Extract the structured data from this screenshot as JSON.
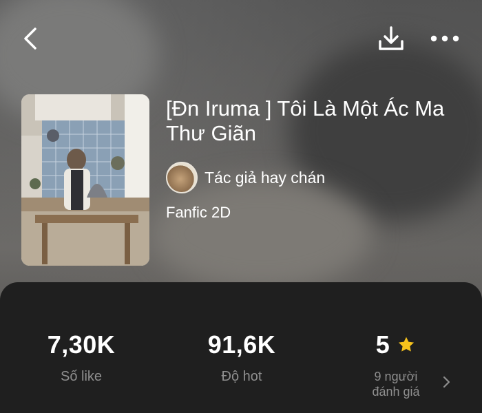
{
  "header": {
    "title": "[Đn Iruma ] Tôi Là Một Ác Ma Thư Giãn",
    "author": "Tác giả hay chán",
    "genre": "Fanfic 2D"
  },
  "stats": {
    "likes": {
      "value": "7,30K",
      "label": "Số like"
    },
    "hot": {
      "value": "91,6K",
      "label": "Độ hot"
    },
    "rating": {
      "value": "5",
      "sub_line1": "9 người",
      "sub_line2": "đánh giá"
    }
  },
  "icons": {
    "back": "chevron-left-icon",
    "download": "download-icon",
    "more": "more-horizontal-icon",
    "star": "star-icon",
    "chevron": "chevron-right-icon"
  },
  "colors": {
    "panel": "#1f1f1f",
    "star": "#f6c21c",
    "label": "#8f8f8f"
  }
}
